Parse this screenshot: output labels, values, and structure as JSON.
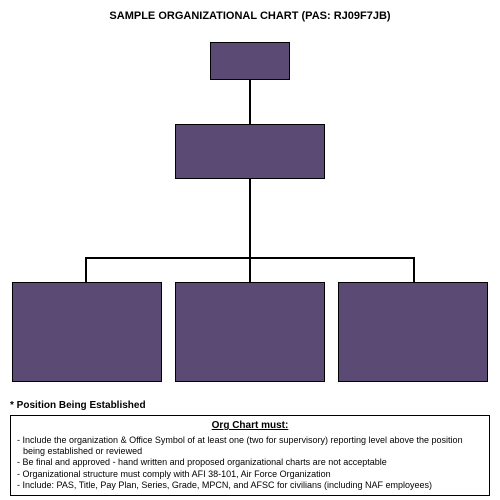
{
  "title": "SAMPLE ORGANIZATIONAL  CHART (PAS: RJ09F7JB)",
  "note": "* Position Being Established",
  "asterisk": "*",
  "footer": {
    "heading": "Org Chart must:",
    "items": [
      "- Include the organization & Office Symbol of at least one (two for supervisory) reporting level above the position being established or reviewed",
      "- Be final and approved - hand written and proposed organizational charts are not acceptable",
      "- Organizational  structure must comply with AFI 38-101, Air Force Organization",
      "- Include: PAS, Title, Pay Plan, Series, Grade, MPCN, and AFSC for civilians (including NAF employees)"
    ]
  }
}
